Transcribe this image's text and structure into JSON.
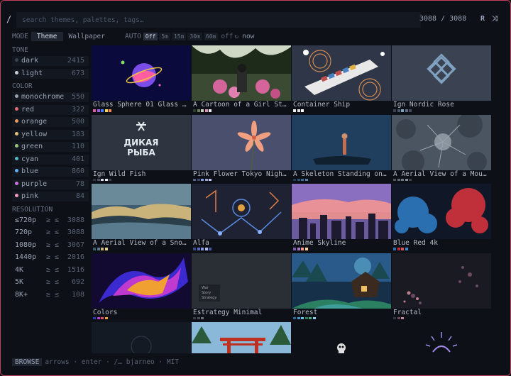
{
  "search": {
    "slash": "/",
    "placeholder": "search themes, palettes, tags…",
    "count": "3088 / 3088"
  },
  "top_icons": [
    {
      "label": "R",
      "icon": "random-letter-icon"
    },
    {
      "label": "⤨",
      "icon": "shuffle-icon"
    }
  ],
  "mode": {
    "label": "MODE",
    "tabs": [
      "Theme",
      "Wallpaper"
    ],
    "active": "Theme"
  },
  "auto": {
    "label": "AUTO",
    "options": [
      "Off",
      "5m",
      "15m",
      "30m",
      "60m"
    ],
    "active": "Off",
    "status": "off",
    "now_label": "now",
    "refresh_icon": "↻"
  },
  "sidebar": {
    "tone_label": "TONE",
    "tone": [
      {
        "label": "dark",
        "count": "2415",
        "color": "#3a4150"
      },
      {
        "label": "light",
        "count": "673",
        "color": "#c9ced8"
      }
    ],
    "color_label": "COLOR",
    "colors": [
      {
        "label": "monochrome",
        "count": "550",
        "color": "#9aa2b4"
      },
      {
        "label": "red",
        "count": "322",
        "color": "#e06c75"
      },
      {
        "label": "orange",
        "count": "500",
        "color": "#e59a5c"
      },
      {
        "label": "yellow",
        "count": "183",
        "color": "#e5c07b"
      },
      {
        "label": "green",
        "count": "110",
        "color": "#98c379"
      },
      {
        "label": "cyan",
        "count": "401",
        "color": "#56b6c2"
      },
      {
        "label": "blue",
        "count": "860",
        "color": "#61afef"
      },
      {
        "label": "purple",
        "count": "78",
        "color": "#c678dd"
      },
      {
        "label": "pink",
        "count": "84",
        "color": "#f19ac4"
      }
    ],
    "resolution_label": "RESOLUTION",
    "resolutions": [
      {
        "label": "≤720p",
        "ge": "≥",
        "le": "≤",
        "count": "3088"
      },
      {
        "label": "720p",
        "ge": "≥",
        "le": "≤",
        "count": "3088"
      },
      {
        "label": "1080p",
        "ge": "≥",
        "le": "≤",
        "count": "3067"
      },
      {
        "label": "1440p",
        "ge": "≥",
        "le": "≤",
        "count": "2016"
      },
      {
        "label": "4K",
        "ge": "≥",
        "le": "≤",
        "count": "1516"
      },
      {
        "label": "5K",
        "ge": "≥",
        "le": "≤",
        "count": "692"
      },
      {
        "label": "8K+",
        "ge": "≥",
        "le": "≤",
        "count": "108"
      }
    ]
  },
  "cards": [
    {
      "title": "Glass Sphere 01 Glass …",
      "palette": [
        "#e35d9b",
        "#9b5de5",
        "#4a7bff",
        "#f4d35e",
        "#ff8c42"
      ]
    },
    {
      "title": "A Cartoon of a Girl St…",
      "palette": [
        "#2f3b2c",
        "#6b7f5a",
        "#c9d1c0",
        "#e08fb6",
        "#f3f3f3"
      ]
    },
    {
      "title": "Container Ship",
      "palette": [
        "#f0f0f0",
        "#e0e0e0",
        "#ffffff"
      ]
    },
    {
      "title": "Ign Nordic Rose",
      "palette": [
        "#3a4150",
        "#4c566a",
        "#81a1c1",
        "#5e6b80",
        "#434c5e"
      ]
    },
    {
      "title": "Ign Wild Fish",
      "palette": [
        "#2e3440",
        "#4c566a",
        "#d8dee9",
        "#e5e9f0",
        "#3b4252"
      ]
    },
    {
      "title": "Pink Flower Tokyo Nigh…",
      "palette": [
        "#565f89",
        "#414868",
        "#7aa2f7",
        "#9aa5ce",
        "#c0caf5"
      ]
    },
    {
      "title": "A Skeleton Standing on…",
      "palette": [
        "#1f3b5a",
        "#2a5176",
        "#3d6d94",
        "#4a7fa8"
      ]
    },
    {
      "title": "A Aerial View of a Mou…",
      "palette": [
        "#4a5561",
        "#5e6a75",
        "#6d7883",
        "#808a93",
        "#3a434d"
      ]
    },
    {
      "title": "A Aerial View of a Sno…",
      "palette": [
        "#3f5d6e",
        "#5a7b8d",
        "#c9b37a",
        "#e4d08f"
      ]
    },
    {
      "title": "Alfa",
      "palette": [
        "#3a4a8a",
        "#5a6ac0",
        "#8a9ae0",
        "#b0bcf0",
        "#4a5aa0"
      ]
    },
    {
      "title": "Anime Skyline",
      "palette": [
        "#7b5ea7",
        "#a678c9",
        "#ff9a8b",
        "#ffd1a1"
      ]
    },
    {
      "title": "Blue Red 4k",
      "palette": [
        "#2a6fb0",
        "#c0303a",
        "#e05050",
        "#3a8ad0"
      ]
    },
    {
      "title": "Colors",
      "palette": [
        "#2a3ac0",
        "#c03ad0",
        "#e0506a",
        "#f0a030"
      ]
    },
    {
      "title": "Estrategy Minimal",
      "palette": [
        "#3a3f47",
        "#4a4f57",
        "#6a6f77"
      ]
    },
    {
      "title": "Forest",
      "palette": [
        "#2a6aa0",
        "#3a9ad0",
        "#6ac0e0",
        "#2a8060",
        "#4ab080",
        "#80d0f0"
      ]
    },
    {
      "title": "Fractal",
      "palette": [
        "#3a3040",
        "#6a4a60",
        "#c08090"
      ]
    },
    {
      "title": "",
      "palette": []
    },
    {
      "title": "",
      "palette": []
    },
    {
      "title": "",
      "palette": []
    },
    {
      "title": "",
      "palette": []
    }
  ],
  "cards_misc": {
    "wild_fish_line1": "ДИКАЯ",
    "wild_fish_line2": "РЫБА",
    "estrategy_lines": [
      "War",
      "Story",
      "Strategy"
    ]
  },
  "bottom": {
    "mode": "BROWSE",
    "hint": "arrows · enter · /… bjarneo · MIT"
  }
}
